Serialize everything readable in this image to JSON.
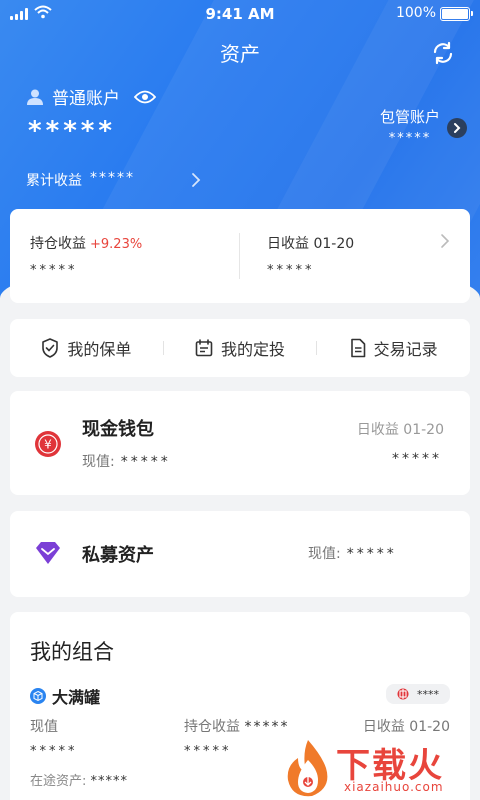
{
  "status_bar": {
    "time": "9:41 AM",
    "battery": "100%"
  },
  "header": {
    "title": "资产"
  },
  "account": {
    "type_label": "普通账户",
    "total_hidden": "*****",
    "managed_label": "包管账户",
    "managed_value": "*****",
    "cumulative_label": "累计收益",
    "cumulative_value": "*****"
  },
  "holding": {
    "label": "持仓收益",
    "pct": "+9.23%",
    "value": "*****",
    "daily_label": "日收益 01-20",
    "daily_value": "*****"
  },
  "menu": {
    "policy": "我的保单",
    "fixed_invest": "我的定投",
    "records": "交易记录"
  },
  "wallet": {
    "title": "现金钱包",
    "value_label": "现值:",
    "value": "*****",
    "daily_label": "日收益 01-20",
    "daily_value": "*****"
  },
  "private_fund": {
    "title": "私募资产",
    "value_label": "现值:",
    "value": "*****"
  },
  "portfolio": {
    "title": "我的组合",
    "name": "大满罐",
    "tag_value": "****",
    "value_label": "现值",
    "value": "*****",
    "hold_label": "持仓收益",
    "hold_value": "*****",
    "hold_value2": "*****",
    "daily_label": "日收益 01-20",
    "transit_label": "在途资产:",
    "transit_value": "*****"
  },
  "watermark": {
    "brand": "下载火",
    "url": "xiazaihuo.com"
  },
  "colors": {
    "primary": "#2a7cf0",
    "positive": "#e8453c",
    "purple": "#7b3fd6"
  }
}
